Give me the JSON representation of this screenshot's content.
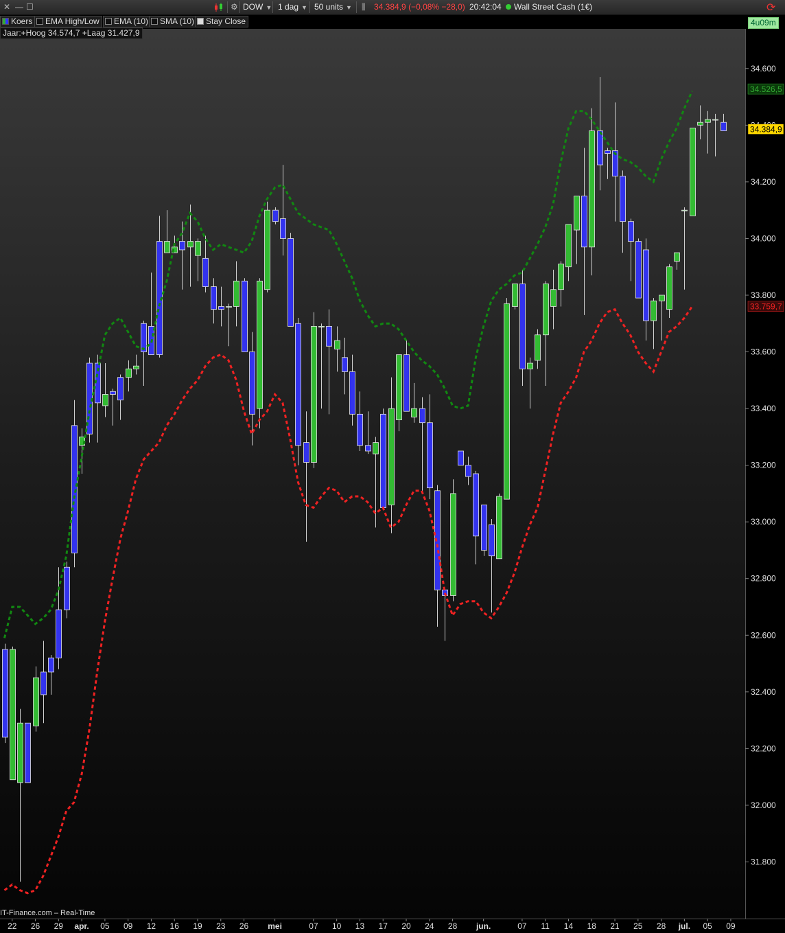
{
  "toolbar": {
    "symbol": "DOW",
    "interval": "1 dag",
    "units": "50 units",
    "price": "34.384,9",
    "change": "(−0,08% −28,0)",
    "time": "20:42:04",
    "instrument": "Wall Street Cash (1€)",
    "status_color": "#33cc33"
  },
  "legend": {
    "koers": "Koers",
    "ema_hl": "EMA High/Low",
    "ema10": "EMA (10)",
    "sma10": "SMA (10)",
    "stay_close": "Stay Close"
  },
  "year_info": "Jaar:+Hoog 34.574,7 +Laag 31.427,9",
  "timer": "4u09m",
  "watermark": "IT-Finance.com – Real-Time",
  "chart_data": {
    "type": "candlestick",
    "colors": {
      "up": "#33bb33",
      "down": "#3333ee",
      "ema_high": "#118811",
      "ema_low": "#ee2222"
    },
    "y_ticks": [
      31800,
      32000,
      32200,
      32400,
      32600,
      32800,
      33000,
      33200,
      33400,
      33600,
      33800,
      34000,
      34200,
      34400,
      34600
    ],
    "y_tick_labels": [
      "31.800",
      "32.000",
      "32.200",
      "32.400",
      "32.600",
      "32.800",
      "33.000",
      "33.200",
      "33.400",
      "33.600",
      "33.800",
      "34.000",
      "34.200",
      "34.400",
      "34.600"
    ],
    "ylim": [
      31600,
      34740
    ],
    "x_labels": [
      {
        "i": 1,
        "t": "22"
      },
      {
        "i": 4,
        "t": "26"
      },
      {
        "i": 7,
        "t": "29"
      },
      {
        "i": 10,
        "t": "apr."
      },
      {
        "i": 13,
        "t": "05"
      },
      {
        "i": 16,
        "t": "09"
      },
      {
        "i": 19,
        "t": "12"
      },
      {
        "i": 22,
        "t": "16"
      },
      {
        "i": 25,
        "t": "19"
      },
      {
        "i": 28,
        "t": "23"
      },
      {
        "i": 31,
        "t": "26"
      },
      {
        "i": 35,
        "t": "mei"
      },
      {
        "i": 40,
        "t": "07"
      },
      {
        "i": 43,
        "t": "10"
      },
      {
        "i": 46,
        "t": "13"
      },
      {
        "i": 49,
        "t": "17"
      },
      {
        "i": 52,
        "t": "20"
      },
      {
        "i": 55,
        "t": "24"
      },
      {
        "i": 58,
        "t": "28"
      },
      {
        "i": 62,
        "t": "jun."
      },
      {
        "i": 67,
        "t": "07"
      },
      {
        "i": 70,
        "t": "11"
      },
      {
        "i": 73,
        "t": "14"
      },
      {
        "i": 76,
        "t": "18"
      },
      {
        "i": 79,
        "t": "21"
      },
      {
        "i": 82,
        "t": "25"
      },
      {
        "i": 85,
        "t": "28"
      },
      {
        "i": 88,
        "t": "jul."
      },
      {
        "i": 91,
        "t": "05"
      },
      {
        "i": 94,
        "t": "09"
      }
    ],
    "price_tags": [
      {
        "value": 34526.5,
        "label": "34.526,5",
        "bg": "#0a3a0a",
        "fg": "#33aa33"
      },
      {
        "value": 34384.9,
        "label": "34.384,9",
        "bg": "#ffd700",
        "fg": "#000000"
      },
      {
        "value": 33759.7,
        "label": "33.759,7",
        "bg": "#3a0a0a",
        "fg": "#ee2222"
      }
    ],
    "candles": [
      [
        32570,
        32220,
        32550,
        32240
      ],
      [
        32560,
        32090,
        32090,
        32550
      ],
      [
        32340,
        31730,
        32080,
        32290
      ],
      [
        32290,
        32090,
        32290,
        32080
      ],
      [
        32490,
        32260,
        32280,
        32450
      ],
      [
        32580,
        32290,
        32470,
        32390
      ],
      [
        32530,
        32390,
        32520,
        32470
      ],
      [
        32840,
        32480,
        32690,
        32520
      ],
      [
        32860,
        32660,
        32840,
        32690
      ],
      [
        33430,
        32840,
        33340,
        32890
      ],
      [
        33330,
        33170,
        33270,
        33300
      ],
      [
        33580,
        33280,
        33560,
        33310
      ],
      [
        33590,
        33280,
        33560,
        33420
      ],
      [
        33560,
        33370,
        33410,
        33450
      ],
      [
        33470,
        33340,
        33460,
        33450
      ],
      [
        33520,
        33360,
        33510,
        33430
      ],
      [
        33570,
        33460,
        33510,
        33540
      ],
      [
        33590,
        33520,
        33540,
        33550
      ],
      [
        33710,
        33480,
        33700,
        33600
      ],
      [
        33880,
        33590,
        33690,
        33590
      ],
      [
        34080,
        33580,
        33990,
        33590
      ],
      [
        34100,
        33970,
        33950,
        33990
      ],
      [
        34010,
        33950,
        33950,
        33970
      ],
      [
        34060,
        33820,
        33990,
        33960
      ],
      [
        34120,
        33830,
        33970,
        33990
      ],
      [
        34000,
        33850,
        33940,
        33990
      ],
      [
        34010,
        33810,
        33930,
        33830
      ],
      [
        33860,
        33700,
        33830,
        33750
      ],
      [
        33830,
        33690,
        33760,
        33750
      ],
      [
        33770,
        33620,
        33760,
        33760
      ],
      [
        33920,
        33690,
        33760,
        33850
      ],
      [
        33860,
        33610,
        33850,
        33600
      ],
      [
        33670,
        33270,
        33600,
        33380
      ],
      [
        33860,
        33330,
        33400,
        33850
      ],
      [
        34130,
        33810,
        33820,
        34100
      ],
      [
        34110,
        34050,
        34100,
        34060
      ],
      [
        34260,
        33940,
        34070,
        34000
      ],
      [
        34020,
        33690,
        34000,
        33690
      ],
      [
        33720,
        33200,
        33700,
        33270
      ],
      [
        33390,
        32930,
        33280,
        33210
      ],
      [
        33740,
        33190,
        33210,
        33690
      ],
      [
        33700,
        33400,
        33690,
        33690
      ],
      [
        33750,
        33380,
        33690,
        33620
      ],
      [
        33690,
        33530,
        33610,
        33640
      ],
      [
        33650,
        33450,
        33580,
        33530
      ],
      [
        33590,
        33340,
        33530,
        33380
      ],
      [
        33460,
        33250,
        33380,
        33270
      ],
      [
        33390,
        33240,
        33270,
        33250
      ],
      [
        33300,
        32980,
        33240,
        33280
      ],
      [
        33400,
        33230,
        33380,
        33050
      ],
      [
        33510,
        32960,
        33060,
        33400
      ],
      [
        33550,
        33320,
        33360,
        33590
      ],
      [
        33640,
        33390,
        33590,
        33390
      ],
      [
        33490,
        33350,
        33370,
        33400
      ],
      [
        33440,
        33100,
        33400,
        33350
      ],
      [
        33450,
        33080,
        33350,
        33120
      ],
      [
        33130,
        32630,
        33110,
        32760
      ],
      [
        32760,
        32580,
        32760,
        32740
      ],
      [
        33150,
        32720,
        32740,
        33100
      ],
      [
        33250,
        33200,
        33250,
        33200
      ],
      [
        33230,
        33130,
        33200,
        33160
      ],
      [
        33180,
        32850,
        33170,
        32950
      ],
      [
        33040,
        32880,
        33060,
        32900
      ],
      [
        33010,
        32680,
        32990,
        32880
      ],
      [
        33100,
        32870,
        32870,
        33090
      ],
      [
        33790,
        33080,
        33080,
        33770
      ],
      [
        33840,
        33750,
        33760,
        33840
      ],
      [
        33890,
        33480,
        33840,
        33540
      ],
      [
        33580,
        33400,
        33540,
        33560
      ],
      [
        33680,
        33540,
        33570,
        33660
      ],
      [
        33850,
        33480,
        33660,
        33840
      ],
      [
        33890,
        33680,
        33760,
        33820
      ],
      [
        33920,
        33760,
        33820,
        33910
      ],
      [
        34050,
        33850,
        33900,
        34050
      ],
      [
        34140,
        33910,
        34030,
        34150
      ],
      [
        34320,
        33730,
        34150,
        33970
      ],
      [
        34460,
        33870,
        33970,
        34380
      ],
      [
        34570,
        34170,
        34380,
        34260
      ],
      [
        34320,
        34210,
        34310,
        34300
      ],
      [
        34480,
        34060,
        34310,
        34220
      ],
      [
        34240,
        33950,
        34220,
        34060
      ],
      [
        34070,
        33850,
        34060,
        33990
      ],
      [
        34000,
        33800,
        33990,
        33790
      ],
      [
        34000,
        33640,
        33960,
        33710
      ],
      [
        33790,
        33610,
        33710,
        33780
      ],
      [
        33790,
        33640,
        33780,
        33800
      ],
      [
        33910,
        33720,
        33750,
        33900
      ],
      [
        33950,
        33890,
        33920,
        33950
      ],
      [
        34110,
        33820,
        34100,
        34100
      ],
      [
        34390,
        34090,
        34080,
        34390
      ],
      [
        34470,
        34350,
        34400,
        34410
      ],
      [
        34450,
        34300,
        34410,
        34420
      ],
      [
        34440,
        34290,
        34420,
        34420
      ],
      [
        34440,
        34380,
        34410,
        34380
      ]
    ],
    "ema_high": [
      [
        0,
        32590
      ],
      [
        1,
        32700
      ],
      [
        2,
        32700
      ],
      [
        3,
        32670
      ],
      [
        4,
        32640
      ],
      [
        5,
        32660
      ],
      [
        6,
        32690
      ],
      [
        7,
        32760
      ],
      [
        8,
        32880
      ],
      [
        9,
        33080
      ],
      [
        10,
        33230
      ],
      [
        11,
        33390
      ],
      [
        12,
        33520
      ],
      [
        13,
        33660
      ],
      [
        14,
        33700
      ],
      [
        15,
        33720
      ],
      [
        16,
        33670
      ],
      [
        17,
        33620
      ],
      [
        18,
        33610
      ],
      [
        19,
        33630
      ],
      [
        20,
        33760
      ],
      [
        21,
        33850
      ],
      [
        22,
        33980
      ],
      [
        23,
        34020
      ],
      [
        24,
        34090
      ],
      [
        25,
        34060
      ],
      [
        26,
        34000
      ],
      [
        27,
        33960
      ],
      [
        28,
        33980
      ],
      [
        29,
        33970
      ],
      [
        30,
        33960
      ],
      [
        31,
        33950
      ],
      [
        32,
        33990
      ],
      [
        33,
        34080
      ],
      [
        34,
        34140
      ],
      [
        35,
        34180
      ],
      [
        36,
        34190
      ],
      [
        37,
        34140
      ],
      [
        38,
        34090
      ],
      [
        39,
        34070
      ],
      [
        40,
        34050
      ],
      [
        41,
        34040
      ],
      [
        42,
        34030
      ],
      [
        43,
        33980
      ],
      [
        44,
        33920
      ],
      [
        45,
        33860
      ],
      [
        46,
        33780
      ],
      [
        47,
        33730
      ],
      [
        48,
        33690
      ],
      [
        49,
        33700
      ],
      [
        50,
        33700
      ],
      [
        51,
        33680
      ],
      [
        52,
        33640
      ],
      [
        53,
        33600
      ],
      [
        54,
        33570
      ],
      [
        55,
        33550
      ],
      [
        56,
        33520
      ],
      [
        57,
        33470
      ],
      [
        58,
        33410
      ],
      [
        59,
        33400
      ],
      [
        60,
        33410
      ],
      [
        61,
        33580
      ],
      [
        62,
        33690
      ],
      [
        63,
        33780
      ],
      [
        64,
        33820
      ],
      [
        65,
        33840
      ],
      [
        66,
        33870
      ],
      [
        67,
        33880
      ],
      [
        68,
        33930
      ],
      [
        69,
        33980
      ],
      [
        70,
        34040
      ],
      [
        71,
        34120
      ],
      [
        72,
        34270
      ],
      [
        73,
        34390
      ],
      [
        74,
        34450
      ],
      [
        75,
        34450
      ],
      [
        76,
        34420
      ],
      [
        77,
        34380
      ],
      [
        78,
        34340
      ],
      [
        79,
        34300
      ],
      [
        80,
        34280
      ],
      [
        81,
        34270
      ],
      [
        82,
        34250
      ],
      [
        83,
        34220
      ],
      [
        84,
        34200
      ],
      [
        85,
        34280
      ],
      [
        86,
        34340
      ],
      [
        87,
        34390
      ],
      [
        88,
        34460
      ],
      [
        89,
        34520
      ]
    ],
    "ema_low": [
      [
        0,
        31700
      ],
      [
        1,
        31720
      ],
      [
        2,
        31700
      ],
      [
        3,
        31690
      ],
      [
        4,
        31700
      ],
      [
        5,
        31750
      ],
      [
        6,
        31820
      ],
      [
        7,
        31890
      ],
      [
        8,
        31980
      ],
      [
        9,
        32010
      ],
      [
        10,
        32110
      ],
      [
        11,
        32270
      ],
      [
        12,
        32470
      ],
      [
        13,
        32650
      ],
      [
        14,
        32800
      ],
      [
        15,
        32940
      ],
      [
        16,
        33040
      ],
      [
        17,
        33150
      ],
      [
        18,
        33220
      ],
      [
        19,
        33250
      ],
      [
        20,
        33280
      ],
      [
        21,
        33340
      ],
      [
        22,
        33380
      ],
      [
        23,
        33430
      ],
      [
        24,
        33470
      ],
      [
        25,
        33500
      ],
      [
        26,
        33550
      ],
      [
        27,
        33580
      ],
      [
        28,
        33590
      ],
      [
        29,
        33570
      ],
      [
        30,
        33500
      ],
      [
        31,
        33390
      ],
      [
        32,
        33310
      ],
      [
        33,
        33360
      ],
      [
        34,
        33390
      ],
      [
        35,
        33450
      ],
      [
        36,
        33420
      ],
      [
        37,
        33290
      ],
      [
        38,
        33140
      ],
      [
        39,
        33060
      ],
      [
        40,
        33050
      ],
      [
        41,
        33090
      ],
      [
        42,
        33120
      ],
      [
        43,
        33110
      ],
      [
        44,
        33070
      ],
      [
        45,
        33090
      ],
      [
        46,
        33090
      ],
      [
        47,
        33070
      ],
      [
        48,
        33030
      ],
      [
        49,
        33050
      ],
      [
        50,
        32980
      ],
      [
        51,
        33000
      ],
      [
        52,
        33060
      ],
      [
        53,
        33110
      ],
      [
        54,
        33110
      ],
      [
        55,
        33040
      ],
      [
        56,
        32920
      ],
      [
        57,
        32750
      ],
      [
        58,
        32670
      ],
      [
        59,
        32710
      ],
      [
        60,
        32720
      ],
      [
        61,
        32720
      ],
      [
        62,
        32680
      ],
      [
        63,
        32660
      ],
      [
        64,
        32700
      ],
      [
        65,
        32750
      ],
      [
        66,
        32820
      ],
      [
        67,
        32910
      ],
      [
        68,
        32990
      ],
      [
        69,
        33050
      ],
      [
        70,
        33180
      ],
      [
        71,
        33310
      ],
      [
        72,
        33420
      ],
      [
        73,
        33460
      ],
      [
        74,
        33510
      ],
      [
        75,
        33600
      ],
      [
        76,
        33640
      ],
      [
        77,
        33700
      ],
      [
        78,
        33740
      ],
      [
        79,
        33750
      ],
      [
        80,
        33700
      ],
      [
        81,
        33660
      ],
      [
        82,
        33600
      ],
      [
        83,
        33560
      ],
      [
        84,
        33530
      ],
      [
        85,
        33600
      ],
      [
        86,
        33670
      ],
      [
        87,
        33690
      ],
      [
        88,
        33720
      ],
      [
        89,
        33760
      ]
    ]
  }
}
